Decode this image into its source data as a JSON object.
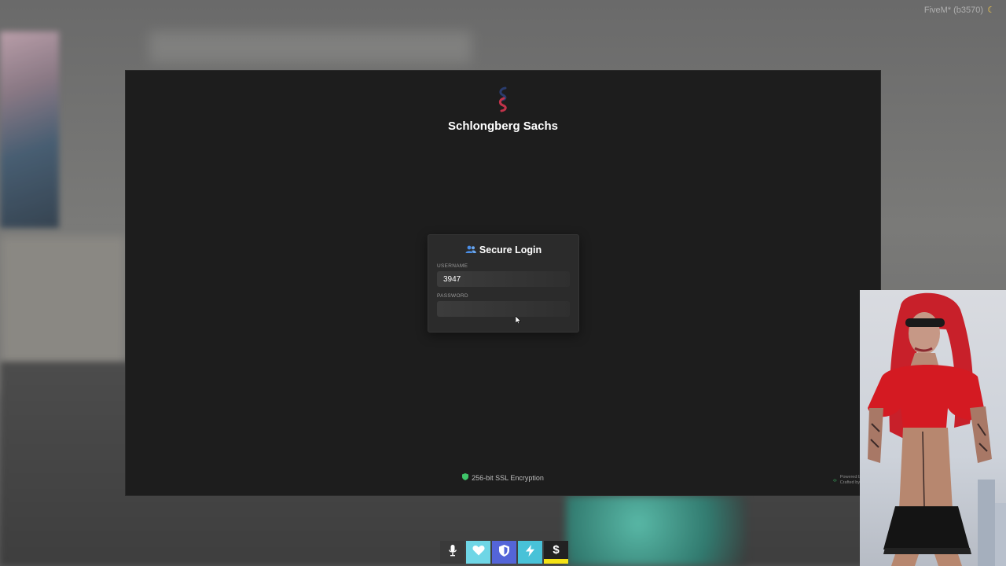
{
  "server": {
    "tag": "FiveM* (b3570)",
    "tag_icon": "moon-icon"
  },
  "app": {
    "brand_name": "Schlongberg Sachs",
    "login": {
      "title": "Secure Login",
      "title_icon": "users-icon",
      "username_label": "USERNAME",
      "username_value": "3947",
      "password_label": "PASSWORD",
      "password_value": ""
    },
    "footer": {
      "ssl_text": "256-bit SSL Encryption",
      "ssl_icon": "shield-icon",
      "powered_line1": "Powered b",
      "powered_line2": "Crafted by"
    }
  },
  "hud": {
    "items": [
      {
        "name": "microphone",
        "icon": "mic-icon"
      },
      {
        "name": "health",
        "icon": "heart-icon",
        "color": "#6fd6e6"
      },
      {
        "name": "armor",
        "icon": "shield-icon",
        "color": "#5465d8"
      },
      {
        "name": "stamina",
        "icon": "bolt-icon",
        "color": "#48c2d8"
      },
      {
        "name": "money",
        "icon": "dollar-icon",
        "color": "#f4e215",
        "symbol": "$"
      }
    ]
  },
  "colors": {
    "brand_logo_top": "#2a3c6e",
    "brand_logo_bottom": "#c2334a",
    "accent_blue": "#4a8ee8",
    "ssl_green": "#3fc56a"
  }
}
